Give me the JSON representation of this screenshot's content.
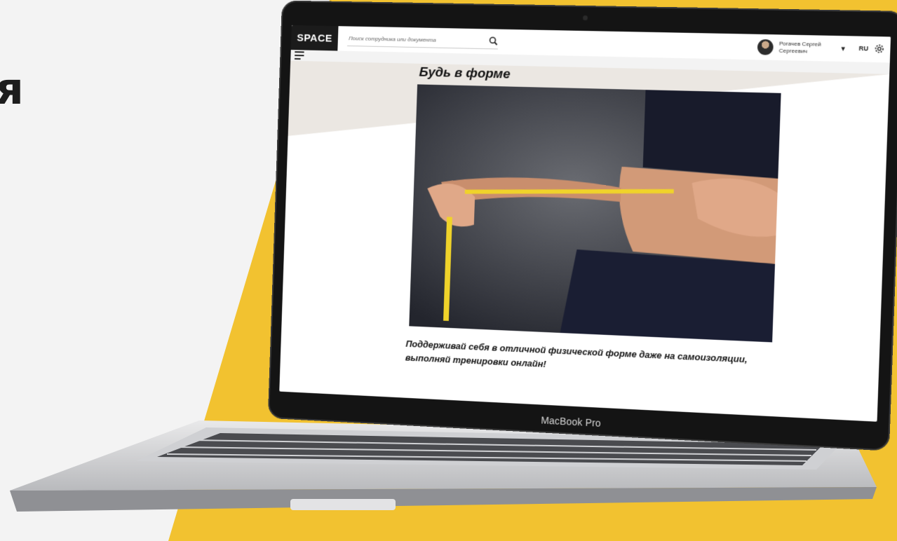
{
  "background": {
    "accent_color": "#f2c230",
    "bg_color": "#f3f3f3",
    "fragment_text": "я"
  },
  "device": {
    "label": "MacBook Pro"
  },
  "app": {
    "logo": "SPACE",
    "search": {
      "placeholder": "Поиск сотрудника или документа",
      "icon": "search-icon"
    },
    "user": {
      "name": "Рогачев Сергей Сергеевич"
    },
    "language": "RU",
    "icons": {
      "settings": "gear-icon",
      "menu": "hamburger-icon",
      "dropdown": "caret-down-icon"
    }
  },
  "article": {
    "title": "Будь в форме",
    "body": "Поддерживай себя в отличной физической форме даже на самоизоляции, выполняй тренировки онлайн!"
  }
}
